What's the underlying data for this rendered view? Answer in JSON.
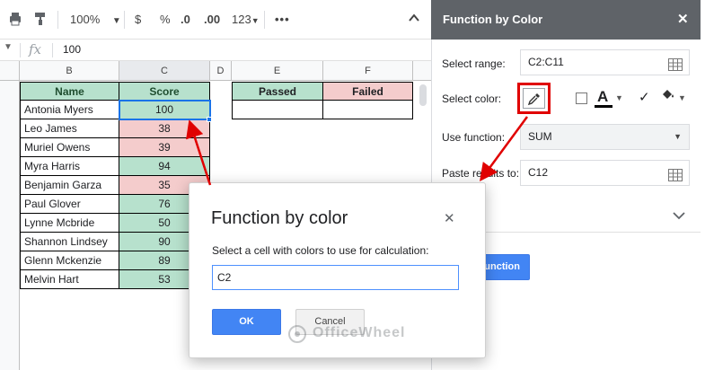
{
  "toolbar": {
    "zoom": "100%",
    "currency": "$",
    "percent": "%",
    "decrease_decimal": ".0",
    "increase_decimal": ".00",
    "more_formats": "123"
  },
  "formula_bar": {
    "fx": "fx",
    "value": "100"
  },
  "columns": [
    "B",
    "C",
    "D",
    "E",
    "F"
  ],
  "table": {
    "headers": {
      "name": "Name",
      "score": "Score"
    },
    "rows": [
      {
        "name": "Antonia Myers",
        "score": "100"
      },
      {
        "name": "Leo James",
        "score": "38"
      },
      {
        "name": "Muriel Owens",
        "score": "39"
      },
      {
        "name": "Myra Harris",
        "score": "94"
      },
      {
        "name": "Benjamin Garza",
        "score": "35"
      },
      {
        "name": "Paul Glover",
        "score": "76"
      },
      {
        "name": "Lynne Mcbride",
        "score": "50"
      },
      {
        "name": "Shannon Lindsey",
        "score": "90"
      },
      {
        "name": "Glenn Mckenzie",
        "score": "89"
      },
      {
        "name": "Melvin Hart",
        "score": "53"
      }
    ],
    "passed_header": "Passed",
    "failed_header": "Failed"
  },
  "panel": {
    "title": "Function by Color",
    "close": "✕",
    "select_range_label": "Select range:",
    "select_range_value": "C2:C11",
    "select_color_label": "Select color:",
    "text_color_glyph": "A",
    "use_function_label": "Use function:",
    "use_function_value": "SUM",
    "paste_results_label": "Paste results to:",
    "paste_results_value": "C12",
    "insert_button": "Function"
  },
  "dialog": {
    "title": "Function by color",
    "close": "✕",
    "prompt": "Select a cell with colors to use for calculation:",
    "input_value": "C2",
    "ok_label": "OK",
    "cancel_label": "Cancel"
  },
  "watermark": "OfficeWheel",
  "colors": {
    "green_cell": "#b7e1cd",
    "pink_cell": "#f4cccc",
    "primary_blue": "#4285f4",
    "annotation_red": "#e00000"
  }
}
